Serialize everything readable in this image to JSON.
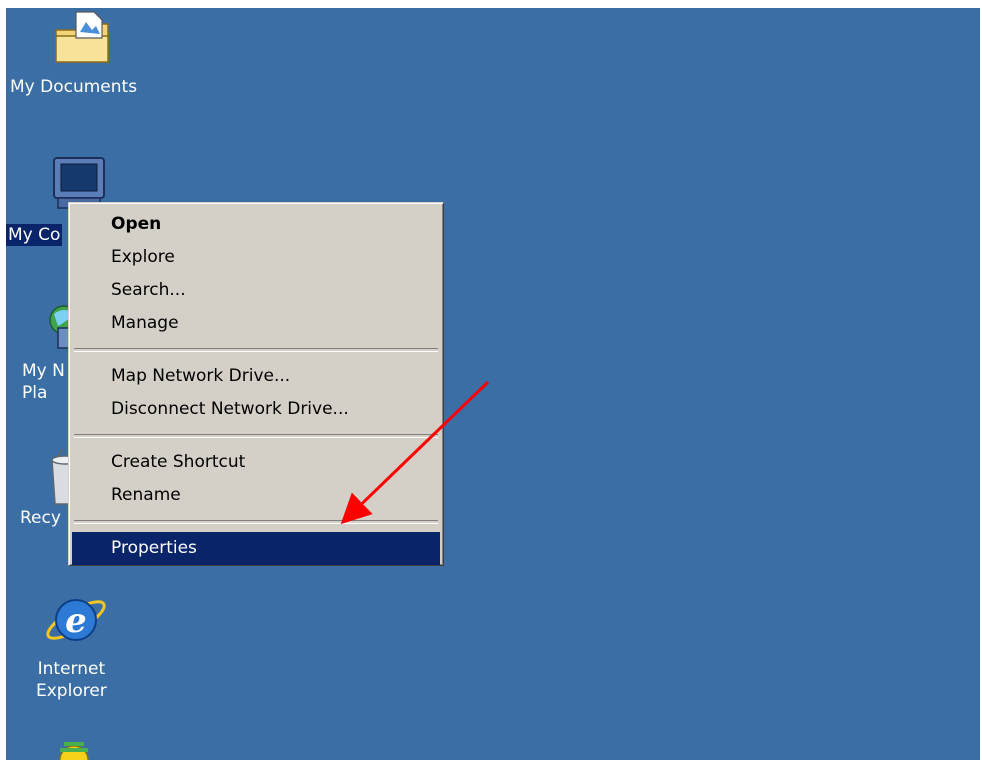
{
  "desktop": {
    "background_color": "#3a6ea5",
    "icons": [
      {
        "label": "My Documents",
        "icon": "my-documents-icon"
      },
      {
        "label": "My Co",
        "icon": "my-computer-icon"
      },
      {
        "label": "My N\nPla",
        "icon": "my-network-places-icon"
      },
      {
        "label": "Recy",
        "icon": "recycle-bin-icon"
      },
      {
        "label": "Internet\nExplorer",
        "icon": "internet-explorer-icon"
      },
      {
        "label": "",
        "icon": "msn-icon"
      }
    ]
  },
  "context_menu": {
    "items": [
      {
        "label": "Open",
        "default": true
      },
      {
        "label": "Explore"
      },
      {
        "label": "Search..."
      },
      {
        "label": "Manage"
      },
      {
        "label": "Map Network Drive..."
      },
      {
        "label": "Disconnect Network Drive..."
      },
      {
        "label": "Create Shortcut"
      },
      {
        "label": "Rename"
      },
      {
        "label": "Properties",
        "highlighted": true
      }
    ],
    "highlight_color": "#0a246a",
    "menu_color": "#d4d0c8"
  },
  "annotation": {
    "arrow_color": "#ff0000",
    "points_to": "Properties"
  }
}
